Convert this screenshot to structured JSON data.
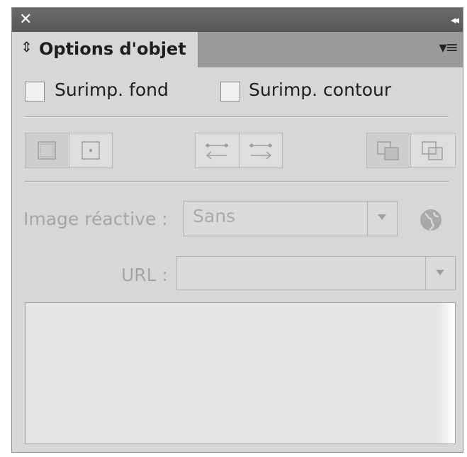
{
  "titlebar": {
    "close_glyph": "✕",
    "collapse_glyph": "◂◂"
  },
  "tab": {
    "updown_glyph": "⇕",
    "title": "Options d'objet"
  },
  "panel_menu_glyph": "▾≡",
  "checkboxes": [
    {
      "label": "Surimp. fond",
      "checked": false
    },
    {
      "label": "Surimp. contour",
      "checked": false
    }
  ],
  "button_groups": [
    {
      "name": "frame-group",
      "buttons": [
        {
          "icon": "frame-fill-icon",
          "selected": true
        },
        {
          "icon": "frame-center-icon",
          "selected": false
        }
      ]
    },
    {
      "name": "arrows-group",
      "buttons": [
        {
          "icon": "arrow-left-icon",
          "selected": false
        },
        {
          "icon": "arrow-right-icon",
          "selected": false
        }
      ]
    },
    {
      "name": "overlap-group",
      "buttons": [
        {
          "icon": "overlap-front-icon",
          "selected": true
        },
        {
          "icon": "overlap-back-icon",
          "selected": false
        }
      ]
    }
  ],
  "image_map": {
    "label": "Image réactive :",
    "value": "Sans",
    "icon": "globe-icon"
  },
  "url": {
    "label": "URL :",
    "value": ""
  },
  "textarea_value": "",
  "colors": {
    "title_bar": "#5f5f5f",
    "panel_bg": "#d7d7d7",
    "disabled_text": "#a5a5a5"
  }
}
